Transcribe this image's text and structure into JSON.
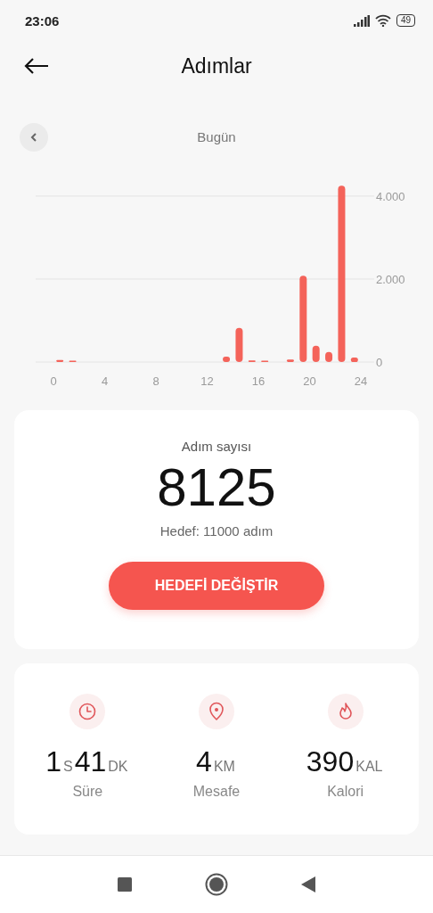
{
  "status_bar": {
    "time": "23:06",
    "battery": "49"
  },
  "header": {
    "title": "Adımlar"
  },
  "date_nav": {
    "label": "Bugün"
  },
  "chart_data": {
    "type": "bar",
    "x": [
      0.5,
      1.5,
      13.5,
      14.5,
      15.5,
      16.5,
      18.5,
      19.5,
      20.5,
      21.5,
      22.5,
      23.5
    ],
    "series": [
      {
        "color": "#f4635a",
        "values": [
          50,
          30,
          130,
          820,
          40,
          30,
          60,
          2080,
          390,
          240,
          4250,
          110
        ]
      }
    ],
    "xlim": [
      0,
      24
    ],
    "ylim": [
      0,
      4300
    ],
    "xticks": [
      0,
      4,
      8,
      12,
      16,
      20,
      24
    ],
    "yticks": [
      {
        "value": 0,
        "label": "0"
      },
      {
        "value": 2000,
        "label": "2.000"
      },
      {
        "value": 4000,
        "label": "4.000"
      }
    ]
  },
  "steps_card": {
    "label": "Adım sayısı",
    "count": "8125",
    "goal": "Hedef: 11000 adım",
    "button": "HEDEFİ DEĞİŞTİR"
  },
  "stats": [
    {
      "kind": "clock",
      "parts": [
        {
          "number": "1",
          "unit": "S"
        },
        {
          "number": "41",
          "unit": "DK"
        }
      ],
      "label": "Süre"
    },
    {
      "kind": "pin",
      "parts": [
        {
          "number": "4",
          "unit": "KM"
        }
      ],
      "label": "Mesafe"
    },
    {
      "kind": "flame",
      "parts": [
        {
          "number": "390",
          "unit": "KAL"
        }
      ],
      "label": "Kalori"
    }
  ]
}
